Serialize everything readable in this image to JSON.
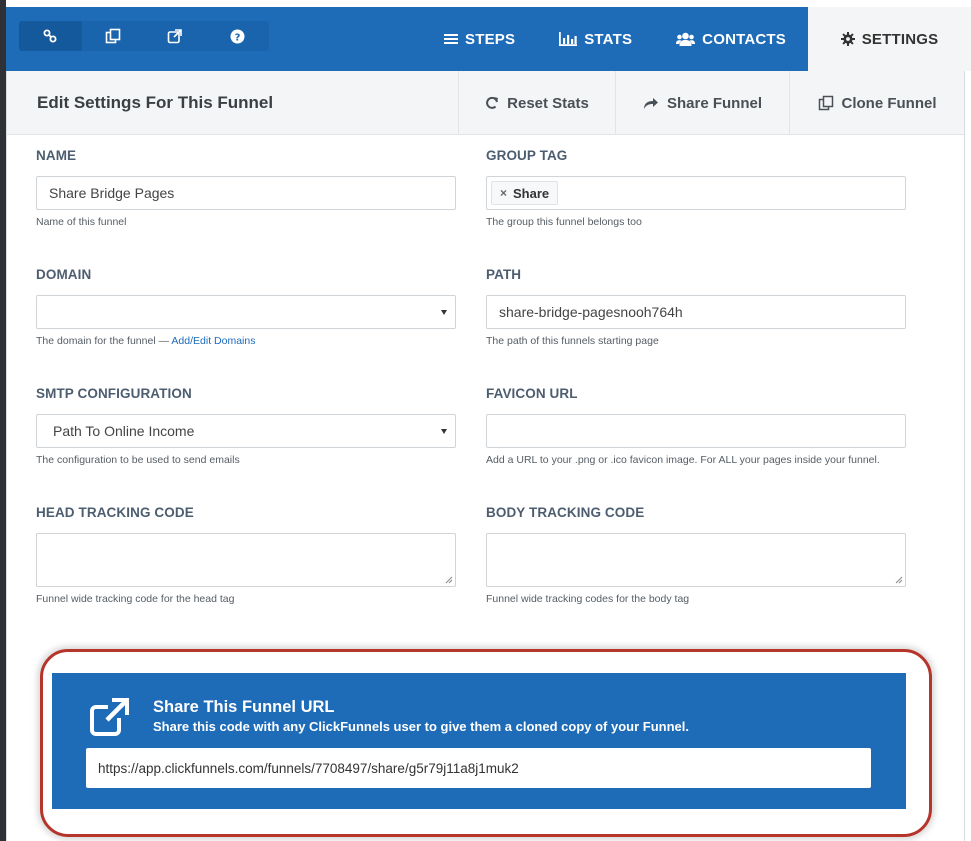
{
  "top_nav": {
    "icon_buttons": [
      {
        "icon": "link-icon"
      },
      {
        "icon": "clone-icon"
      },
      {
        "icon": "external-link-icon"
      },
      {
        "icon": "help-icon"
      }
    ],
    "tabs": [
      {
        "label": "STEPS",
        "icon": "list-icon"
      },
      {
        "label": "STATS",
        "icon": "bar-chart-icon"
      },
      {
        "label": "CONTACTS",
        "icon": "users-icon"
      },
      {
        "label": "SETTINGS",
        "icon": "gear-icon",
        "active": true
      }
    ]
  },
  "panel": {
    "title": "Edit Settings For This Funnel",
    "actions": [
      {
        "label": "Reset Stats",
        "icon": "refresh-icon"
      },
      {
        "label": "Share Funnel",
        "icon": "share-icon"
      },
      {
        "label": "Clone Funnel",
        "icon": "clone-icon"
      }
    ]
  },
  "fields": {
    "name": {
      "label": "NAME",
      "value": "Share Bridge Pages",
      "help": "Name of this funnel"
    },
    "group_tag": {
      "label": "GROUP TAG",
      "tag": "Share",
      "help": "The group this funnel belongs too"
    },
    "domain": {
      "label": "DOMAIN",
      "value": "",
      "help": "The domain for the funnel —",
      "link": "Add/Edit Domains"
    },
    "path": {
      "label": "PATH",
      "value": "share-bridge-pagesnooh764h",
      "help": "The path of this funnels starting page"
    },
    "smtp": {
      "label": "SMTP CONFIGURATION",
      "value": "Path To Online Income",
      "help": "The configuration to be used to send emails"
    },
    "favicon": {
      "label": "FAVICON URL",
      "value": "",
      "help": "Add a URL to your .png or .ico favicon image. For ALL your pages inside your funnel."
    },
    "head_code": {
      "label": "HEAD TRACKING CODE",
      "value": "",
      "help": "Funnel wide tracking code for the head tag"
    },
    "body_code": {
      "label": "BODY TRACKING CODE",
      "value": "",
      "help": "Funnel wide tracking codes for the body tag"
    }
  },
  "share": {
    "title": "Share This Funnel URL",
    "subtitle": "Share this code with any ClickFunnels user to give them a cloned copy of your Funnel.",
    "url": "https://app.clickfunnels.com/funnels/7708497/share/g5r79j11a8j1muk2"
  },
  "colors": {
    "brand_blue": "#1e6bb8",
    "highlight_red": "#b5352a"
  }
}
